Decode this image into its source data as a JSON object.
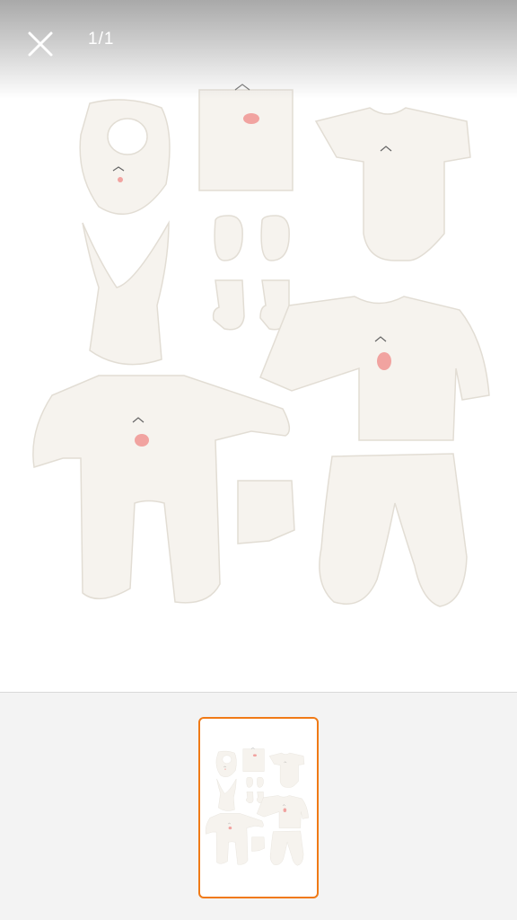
{
  "viewer": {
    "counter": "1/1",
    "close_icon": "close-icon"
  },
  "thumbnail": {
    "selected_border_color": "#f07a16"
  },
  "colors": {
    "garment": "#f6f3ee",
    "garment_stroke": "#e2ddd4",
    "accent_pink": "#f1a3a0"
  }
}
